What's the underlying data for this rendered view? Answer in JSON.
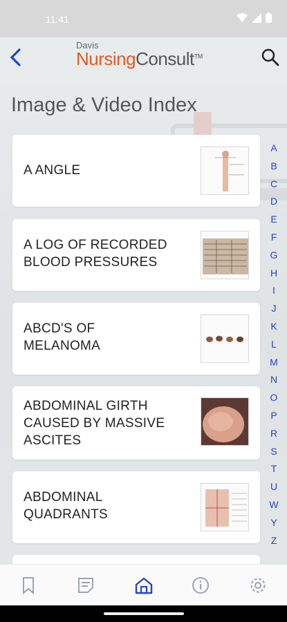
{
  "status_bar": {
    "time": "11:41"
  },
  "header": {
    "brand_small": "Davis",
    "brand_part1": "Nursing",
    "brand_part2": "Consult",
    "brand_tm": "TM"
  },
  "page": {
    "title": "Image & Video Index"
  },
  "items": [
    {
      "lines": [
        "A ANGLE"
      ],
      "thumb": "anatomy-diagram"
    },
    {
      "lines": [
        "A LOG OF RECORDED",
        "BLOOD PRESSURES"
      ],
      "thumb": "log-sheet"
    },
    {
      "lines": [
        "ABCD'S OF",
        "MELANOMA"
      ],
      "thumb": "melanoma-spots"
    },
    {
      "lines": [
        "ABDOMINAL GIRTH",
        "CAUSED BY MASSIVE",
        "ASCITES"
      ],
      "thumb": "abdomen-photo"
    },
    {
      "lines": [
        "ABDOMINAL",
        "QUADRANTS"
      ],
      "thumb": "quadrants-diagram"
    }
  ],
  "alphabet": [
    "A",
    "B",
    "C",
    "D",
    "E",
    "F",
    "G",
    "H",
    "I",
    "J",
    "K",
    "L",
    "M",
    "N",
    "O",
    "P",
    "R",
    "S",
    "T",
    "U",
    "W",
    "Y",
    "Z"
  ],
  "bottom_nav": [
    "bookmark-icon",
    "notes-icon",
    "home-icon",
    "info-icon",
    "settings-icon"
  ],
  "colors": {
    "accent": "#2244cc",
    "brand_orange": "#e05a20",
    "status_bar": "#d8d8d8"
  }
}
